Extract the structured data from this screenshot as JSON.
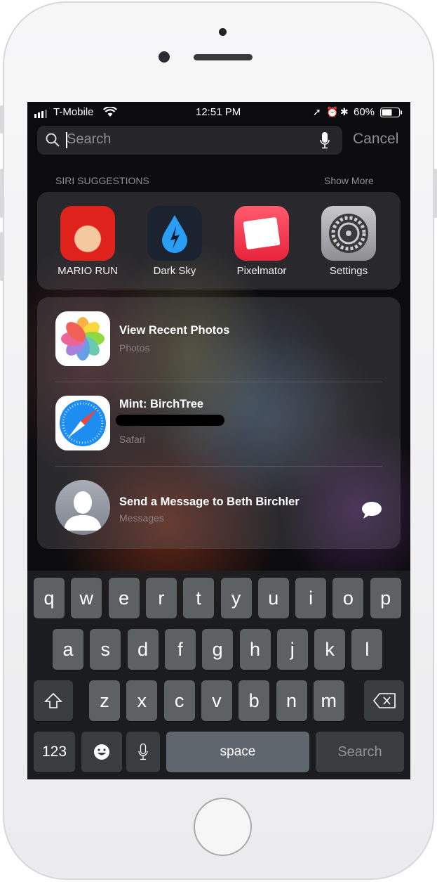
{
  "status": {
    "carrier": "T-Mobile",
    "time": "12:51 PM",
    "battery": "60%"
  },
  "search": {
    "placeholder": "Search",
    "cancel": "Cancel"
  },
  "siri": {
    "header": "SIRI SUGGESTIONS",
    "show_more": "Show More",
    "apps": [
      {
        "label": "MARIO RUN",
        "color": "#e0221c"
      },
      {
        "label": "Dark Sky",
        "color": "#1c2330"
      },
      {
        "label": "Pixelmator",
        "color": "#f0324a"
      },
      {
        "label": "Settings",
        "color": "#8e8e93"
      }
    ]
  },
  "results": [
    {
      "title": "View Recent Photos",
      "subtitle": "Photos",
      "icon": "photos-icon"
    },
    {
      "title": "Mint: BirchTree",
      "subtitle": "Safari",
      "icon": "safari-icon",
      "redacted": true
    },
    {
      "title": "Send a Message to Beth Birchler",
      "subtitle": "Messages",
      "icon": "contact-avatar-icon",
      "action": "message-bubble-icon"
    }
  ],
  "keyboard": {
    "row1": [
      "q",
      "w",
      "e",
      "r",
      "t",
      "y",
      "u",
      "i",
      "o",
      "p"
    ],
    "row2": [
      "a",
      "s",
      "d",
      "f",
      "g",
      "h",
      "j",
      "k",
      "l"
    ],
    "row3": [
      "z",
      "x",
      "c",
      "v",
      "b",
      "n",
      "m"
    ],
    "numbers": "123",
    "space": "space",
    "search": "Search"
  }
}
